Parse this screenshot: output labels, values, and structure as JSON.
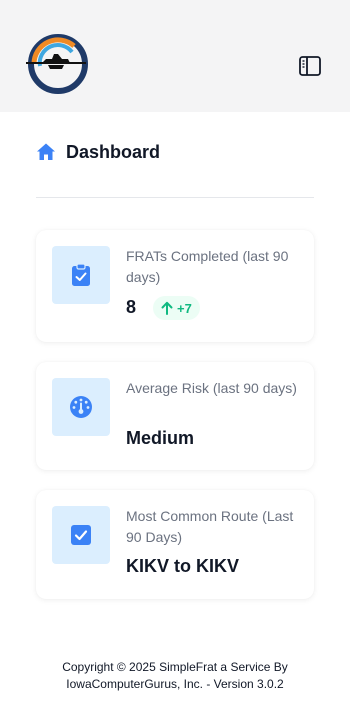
{
  "header": {
    "logo_icon": "airplane-logo-icon",
    "sidebar_toggle_icon": "sidebar-toggle-icon"
  },
  "breadcrumb": {
    "icon": "home-icon",
    "title": "Dashboard"
  },
  "stats": [
    {
      "icon": "clipboard-check-icon",
      "label": "FRATs Completed (last 90 days)",
      "value": "8",
      "delta": "+7",
      "delta_icon": "arrow-up-icon"
    },
    {
      "icon": "gauge-icon",
      "label": "Average Risk (last 90 days)",
      "value": "Medium"
    },
    {
      "icon": "checkbox-icon",
      "label": "Most Common Route (Last 90 Days)",
      "value": "KIKV to KIKV"
    }
  ],
  "footer": {
    "line1": "Copyright © 2025 SimpleFrat a Service By",
    "line2": "IowaComputerGurus, Inc. - Version 3.0.2"
  },
  "colors": {
    "accent": "#3b82f6",
    "icon_box": "#dbeefe",
    "delta_green": "#10b981",
    "delta_bg": "#ecfdf5"
  }
}
